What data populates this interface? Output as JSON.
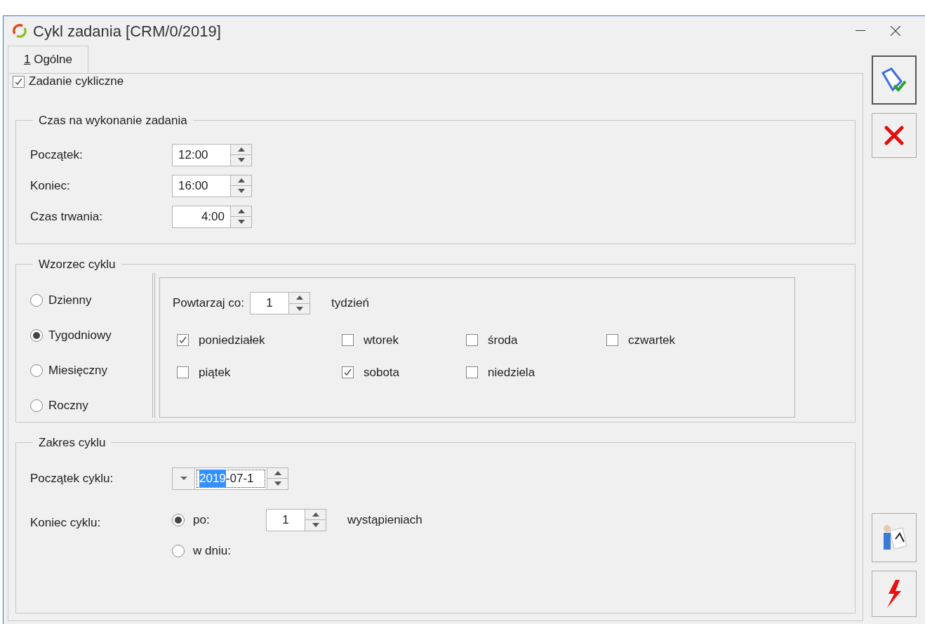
{
  "window": {
    "title": "Cykl zadania [CRM/0/2019]"
  },
  "tabs": [
    {
      "hotkey": "1",
      "label": " Ogólne",
      "selected": true
    }
  ],
  "cyclic": {
    "label": "Zadanie cykliczne",
    "checked": true
  },
  "time_section": {
    "title": "Czas na wykonanie zadania",
    "fields": [
      {
        "label": "Początek:",
        "value": "12:00",
        "right_aligned": false
      },
      {
        "label": "Koniec:",
        "value": "16:00",
        "right_aligned": false
      },
      {
        "label": "Czas trwania:",
        "value": "4:00",
        "right_aligned": true
      }
    ]
  },
  "pattern_section": {
    "title": "Wzorzec cyklu",
    "options": [
      {
        "label": "Dzienny",
        "selected": false
      },
      {
        "label": "Tygodniowy",
        "selected": true
      },
      {
        "label": "Miesięczny",
        "selected": false
      },
      {
        "label": "Roczny",
        "selected": false
      }
    ],
    "repeat_label": "Powtarzaj co:",
    "repeat_value": "1",
    "repeat_unit": "tydzień",
    "days": [
      {
        "label": "poniedziałek",
        "checked": true
      },
      {
        "label": "wtorek",
        "checked": false
      },
      {
        "label": "środa",
        "checked": false
      },
      {
        "label": "czwartek",
        "checked": false
      },
      {
        "label": "piątek",
        "checked": false
      },
      {
        "label": "sobota",
        "checked": true
      },
      {
        "label": "niedziela",
        "checked": false
      }
    ]
  },
  "range_section": {
    "title": "Zakres cyklu",
    "start_label": "Początek cyklu:",
    "start_value": [
      {
        "text": "2019",
        "selected": true
      },
      {
        "text": "-07-1",
        "selected": false
      }
    ],
    "end_label": "Koniec cyklu:",
    "end_options": [
      {
        "label": "po:",
        "selected": true,
        "value": "1",
        "unit": "wystąpieniach"
      },
      {
        "label": "w dniu:",
        "selected": false
      }
    ]
  }
}
